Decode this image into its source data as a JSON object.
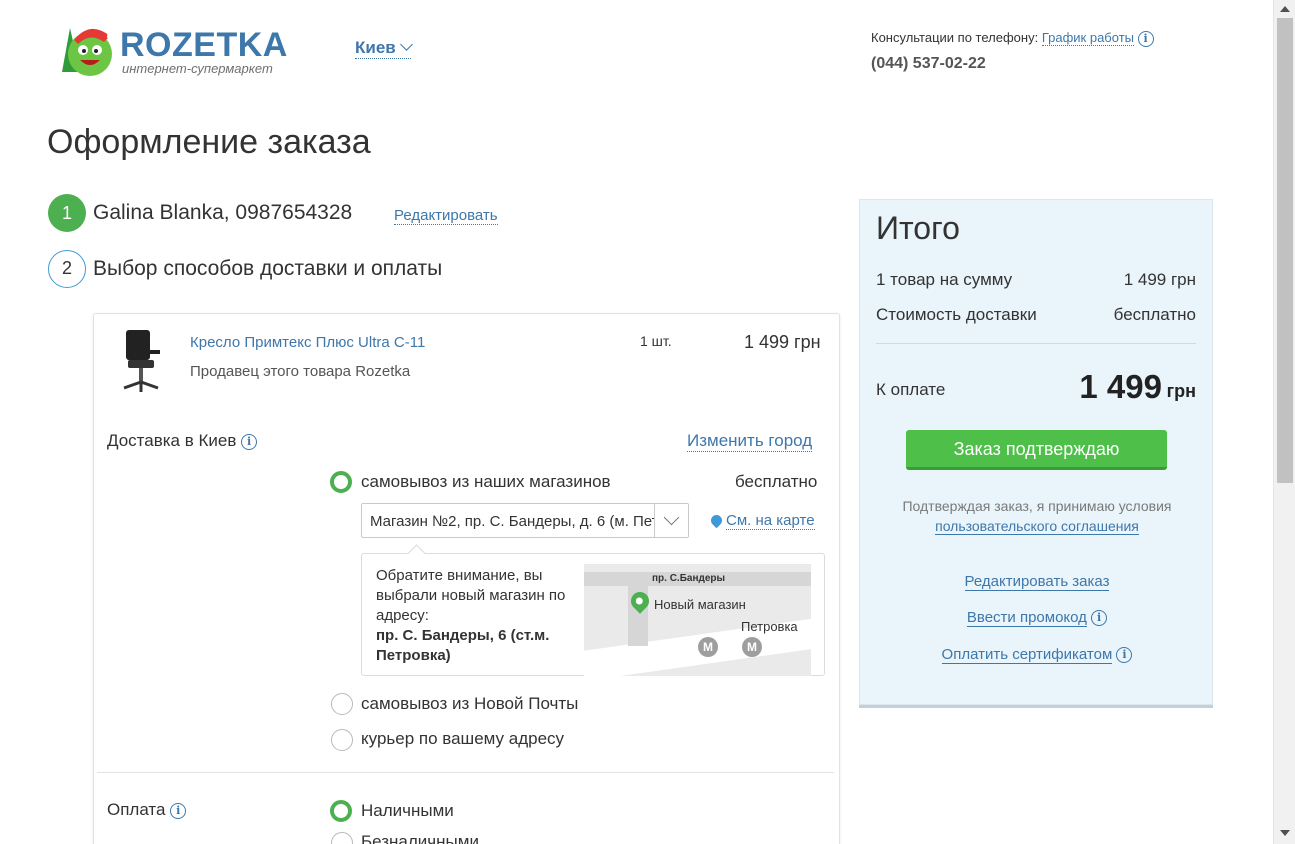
{
  "header": {
    "logo_text": "ROZETKA",
    "logo_sub": "интернет-супермаркет",
    "city": "Киев",
    "consult_label": "Консультации по телефону:",
    "schedule_link": "График работы",
    "phone": "(044) 537-02-22"
  },
  "page": {
    "title": "Оформление заказа"
  },
  "steps": [
    {
      "num": "1",
      "text": "Galina Blanka, 0987654328",
      "edit_link": "Редактировать"
    },
    {
      "num": "2",
      "text": "Выбор способов доставки и оплаты"
    }
  ],
  "product": {
    "name": "Кресло Примтекс Плюс Ultra C-11",
    "seller": "Продавец этого товара  Rozetka",
    "qty": "1 шт.",
    "price": "1 499 грн"
  },
  "delivery": {
    "label": "Доставка в Киев",
    "change_city": "Изменить город",
    "options": [
      {
        "label": "самовывоз из наших магазинов",
        "price": "бесплатно",
        "selected": true
      },
      {
        "label": "самовывоз из Новой Почты",
        "selected": false
      },
      {
        "label": "курьер по вашему адресу",
        "selected": false
      }
    ],
    "store_select": "Магазин №2, пр. С. Бандеры, д. 6 (м. Пет",
    "map_link": "См. на карте",
    "notice": "Обратите внимание, вы выбрали новый магазин по адресу:",
    "notice_address": "пр. С. Бандеры, 6 (ст.м. Петровка)",
    "map": {
      "street": "пр. С.Бандеры",
      "shop": "Новый магазин",
      "metro": "Петровка",
      "metro_sign": "М"
    }
  },
  "payment": {
    "label": "Оплата",
    "options": [
      {
        "label": "Наличными",
        "selected": true
      },
      {
        "label": "Безналичными",
        "selected": false
      }
    ]
  },
  "summary": {
    "title": "Итого",
    "items_label": "1 товар на сумму",
    "items_value": "1 499 грн",
    "delivery_label": "Стоимость доставки",
    "delivery_value": "бесплатно",
    "pay_label": "К оплате",
    "pay_amount": "1 499",
    "pay_currency": "грн",
    "confirm_button": "Заказ подтверждаю",
    "agree_text": "Подтверждая заказ, я принимаю условия",
    "agree_link": "пользовательского соглашения",
    "edit_order": "Редактировать заказ",
    "promo": "Ввести промокод",
    "certificate": "Оплатить сертификатом"
  },
  "colors": {
    "accent": "#3e77aa",
    "green": "#4caf50",
    "summary_bg": "#e9f4fb"
  },
  "icons": {
    "info": "i"
  }
}
